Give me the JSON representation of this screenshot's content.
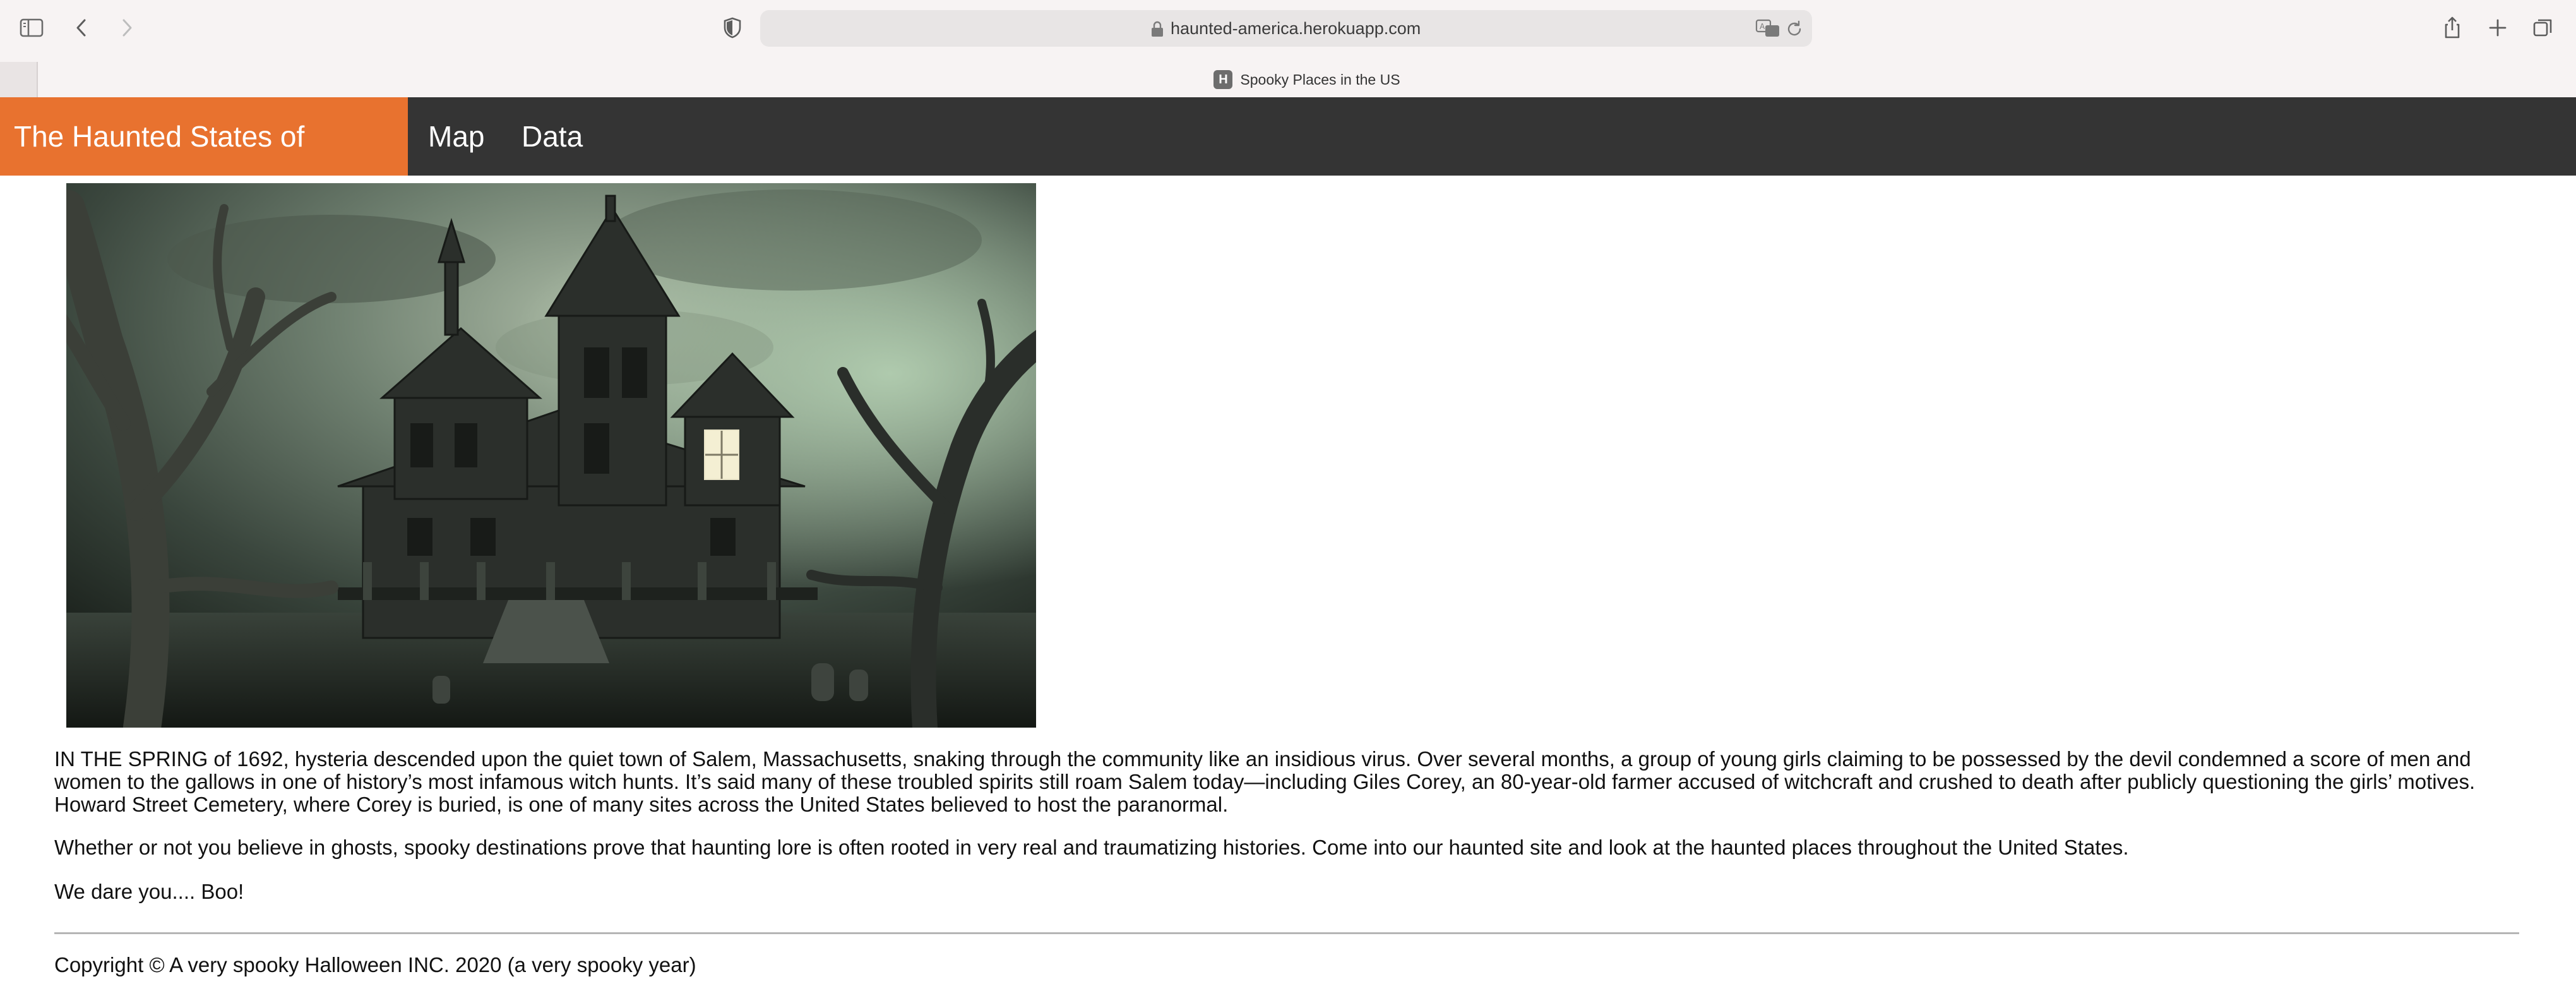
{
  "browser": {
    "url": "haunted-america.herokuapp.com",
    "tab_title": "Spooky Places in the US",
    "favicon_letter": "H"
  },
  "nav": {
    "brand": "The Haunted States of America",
    "links": [
      "Map",
      "Data"
    ],
    "brand_color": "#e8722f",
    "bar_color": "#343434"
  },
  "hero_image": {
    "description_icon": "haunted-mansion-image"
  },
  "content": {
    "paragraphs": [
      "IN THE SPRING of 1692, hysteria descended upon the quiet town of Salem, Massachusetts, snaking through the community like an insidious virus. Over several months, a group of young girls claiming to be possessed by the devil condemned a score of men and women to the gallows in one of history’s most infamous witch hunts. It’s said many of these troubled spirits still roam Salem today—including Giles Corey, an 80-year-old farmer accused of witchcraft and crushed to death after publicly questioning the girls’ motives. Howard Street Cemetery, where Corey is buried, is one of many sites across the United States believed to host the paranormal.",
      "Whether or not you believe in ghosts, spooky destinations prove that haunting lore is often rooted in very real and traumatizing histories. Come into our haunted site and look at the haunted places throughout the United States.",
      "We dare you.... Boo!"
    ]
  },
  "footer": {
    "text": "Copyright © A very spooky Halloween INC. 2020 (a very spooky year)"
  }
}
